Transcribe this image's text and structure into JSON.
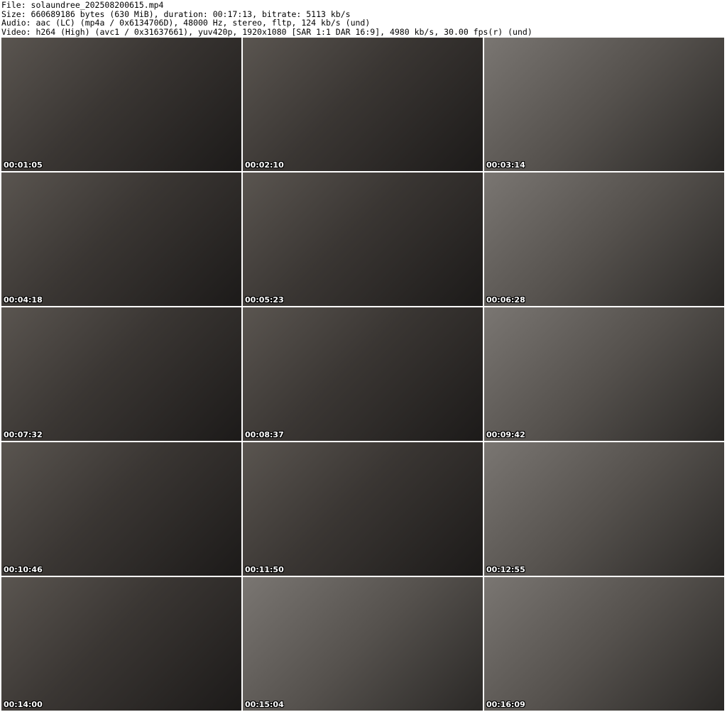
{
  "header": {
    "file": "File: solaundree_202508200615.mp4",
    "size": "Size: 660689186 bytes (630 MiB), duration: 00:17:13, bitrate: 5113 kb/s",
    "audio": "Audio: aac (LC) (mp4a / 0x6134706D), 48000 Hz, stereo, fltp, 124 kb/s (und)",
    "video": "Video: h264 (High) (avc1 / 0x31637661), yuv420p, 1920x1080 [SAR 1:1 DAR 16:9], 4980 kb/s, 30.00 fps(r) (und)"
  },
  "thumbnails": [
    {
      "timestamp": "00:01:05"
    },
    {
      "timestamp": "00:02:10"
    },
    {
      "timestamp": "00:03:14"
    },
    {
      "timestamp": "00:04:18"
    },
    {
      "timestamp": "00:05:23"
    },
    {
      "timestamp": "00:06:28"
    },
    {
      "timestamp": "00:07:32"
    },
    {
      "timestamp": "00:08:37"
    },
    {
      "timestamp": "00:09:42"
    },
    {
      "timestamp": "00:10:46"
    },
    {
      "timestamp": "00:11:50"
    },
    {
      "timestamp": "00:12:55"
    },
    {
      "timestamp": "00:14:00"
    },
    {
      "timestamp": "00:15:04"
    },
    {
      "timestamp": "00:16:09"
    }
  ]
}
